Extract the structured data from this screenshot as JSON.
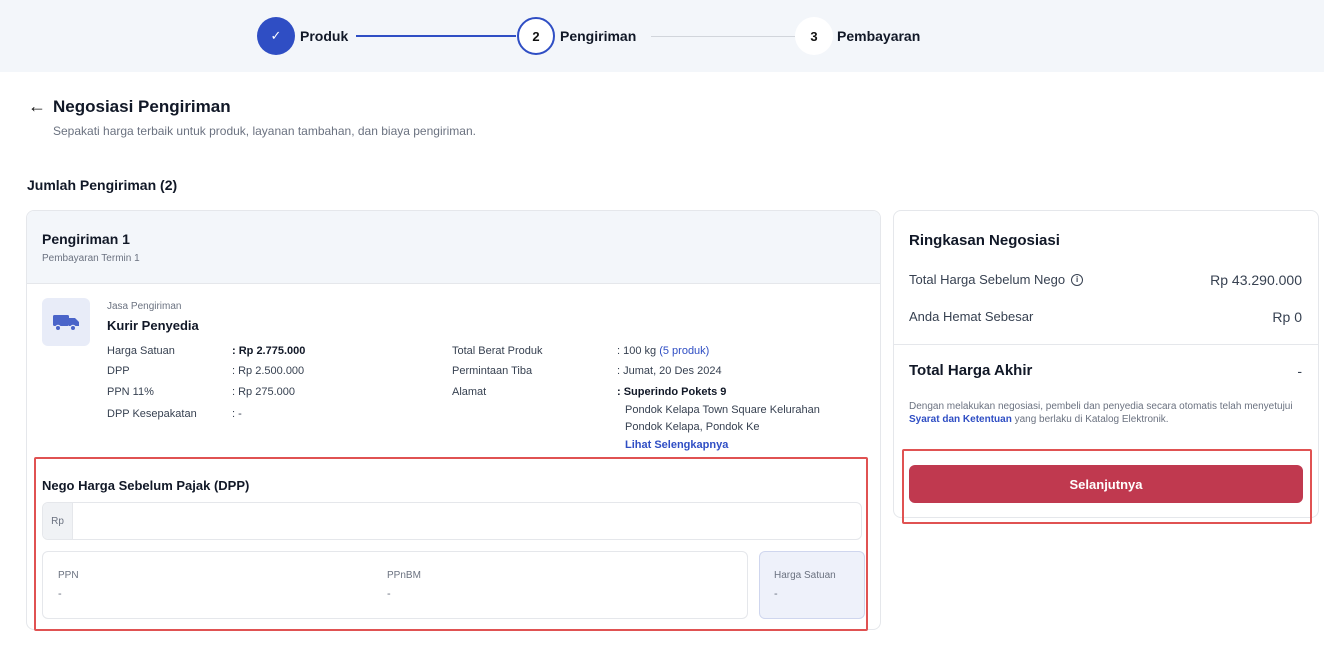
{
  "stepper": {
    "steps": [
      {
        "number": "✓",
        "label": "Produk"
      },
      {
        "number": "2",
        "label": "Pengiriman"
      },
      {
        "number": "3",
        "label": "Pembayaran"
      }
    ]
  },
  "header": {
    "back_icon": "←",
    "title": "Negosiasi Pengiriman",
    "subtitle": "Sepakati harga terbaik untuk produk, layanan tambahan, dan biaya pengiriman."
  },
  "section": {
    "title": "Jumlah Pengiriman (2)"
  },
  "shipment": {
    "title": "Pengiriman 1",
    "subtitle": "Pembayaran Termin 1",
    "service_label": "Jasa Pengiriman",
    "service_name": "Kurir Penyedia",
    "left_details": [
      {
        "label": "Harga Satuan",
        "value": ": Rp 2.775.000"
      },
      {
        "label": "DPP",
        "value": ": Rp 2.500.000"
      },
      {
        "label": "PPN 11%",
        "value": ": Rp 275.000"
      },
      {
        "label": "DPP Kesepakatan",
        "value": ": -"
      }
    ],
    "right_details": {
      "weight_label": "Total Berat Produk",
      "weight_value": ": 100 kg",
      "weight_link": "(5 produk)",
      "arrival_label": "Permintaan Tiba",
      "arrival_value": ": Jumat, 20 Des 2024",
      "address_label": "Alamat",
      "address_name": ": Superindo Pokets 9",
      "address_line1": "Pondok Kelapa Town Square Kelurahan",
      "address_line2": "Pondok Kelapa, Pondok Ke",
      "address_more": "Lihat Selengkapnya"
    },
    "nego": {
      "title": "Nego Harga Sebelum Pajak (DPP)",
      "currency_prefix": "Rp",
      "input_value": "",
      "ppn_label": "PPN",
      "ppn_value": "-",
      "ppnbm_label": "PPnBM",
      "ppnbm_value": "-",
      "unit_price_label": "Harga Satuan",
      "unit_price_value": "-"
    }
  },
  "summary": {
    "title": "Ringkasan Negosiasi",
    "before_label": "Total Harga Sebelum Nego",
    "before_value": "Rp 43.290.000",
    "saving_label": "Anda Hemat Sebesar",
    "saving_value": "Rp 0",
    "total_label": "Total Harga Akhir",
    "total_value": "-",
    "note_prefix": "Dengan melakukan negosiasi, pembeli dan penyedia secara otomatis telah menyetujui ",
    "note_link": "Syarat dan Ketentuan",
    "note_suffix": " yang berlaku di Katalog Elektronik.",
    "next_button": "Selanjutnya"
  },
  "colors": {
    "primary": "#2f4ec4",
    "button": "#c0394f",
    "highlight": "#e05252"
  }
}
